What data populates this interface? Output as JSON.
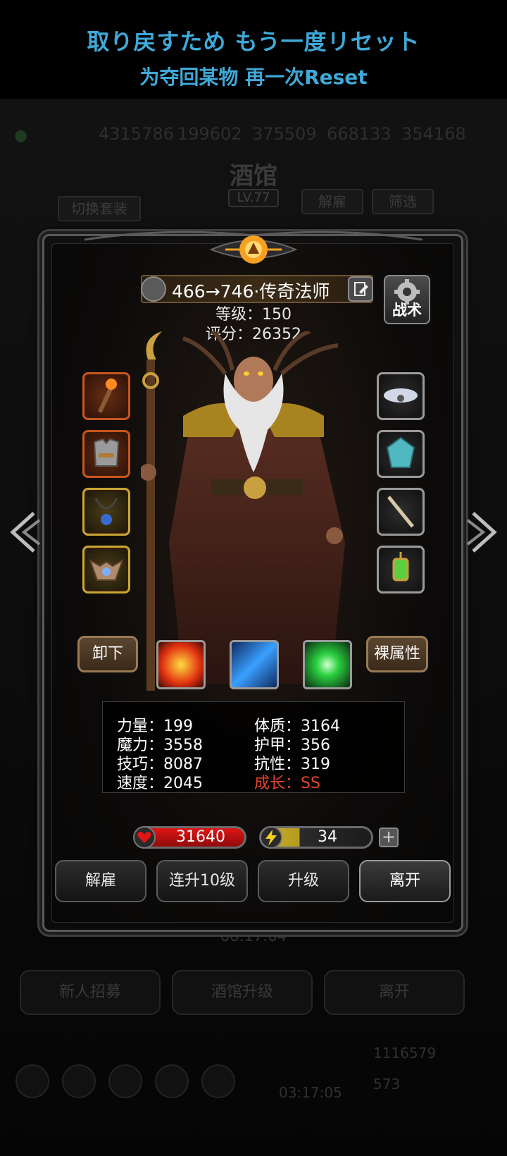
{
  "promo": {
    "japanese": "取り戻すため もう一度リセット",
    "chinese": "为夺回某物 再一次Reset"
  },
  "background": {
    "resources": [
      "4315786",
      "199602",
      "375509",
      "668133",
      "354168"
    ],
    "title": "酒馆",
    "level": "LV.77",
    "switch_outfit_label": "切换套装",
    "dismiss_label": "解雇",
    "filter_label": "筛选",
    "timer": "00:17:04",
    "buttons": [
      "新人招募",
      "酒馆升级",
      "离开"
    ],
    "gold": "1116579",
    "gems": "573",
    "bottom_timer": "03:17:05"
  },
  "hero": {
    "name": "466→746·传奇法师",
    "level_label": "等级：150",
    "score_label": "评分：26352",
    "tactic_label": "战术"
  },
  "equipment": {
    "left": [
      "staff-icon",
      "armor-icon",
      "necklace-icon",
      "helm-icon"
    ],
    "right": [
      "cloud-icon",
      "gem-icon",
      "wand-icon",
      "lantern-icon"
    ]
  },
  "actions": {
    "unequip_label": "卸下",
    "naked_stats_label": "裸属性",
    "skills": [
      "fire-skill-icon",
      "ice-skill-icon",
      "nature-skill-icon"
    ]
  },
  "stats": {
    "strength": "力量：199",
    "constitution": "体质：3164",
    "magic": "魔力：3558",
    "armor": "护甲：356",
    "skill": "技巧：8087",
    "resistance": "抗性：319",
    "speed": "速度：2045",
    "growth": "成长：SS"
  },
  "bars": {
    "hp": "31640",
    "energy": "34",
    "energy_fill": 0.35,
    "plus": "+"
  },
  "buttons": {
    "dismiss": "解雇",
    "level_up_10": "连升10级",
    "level_up": "升级",
    "leave": "离开"
  },
  "colors": {
    "promo_text": "#3fa9d8",
    "growth_text": "#e0452b",
    "hp_bar": "#e01515",
    "energy_bar": "#cbb32a"
  }
}
